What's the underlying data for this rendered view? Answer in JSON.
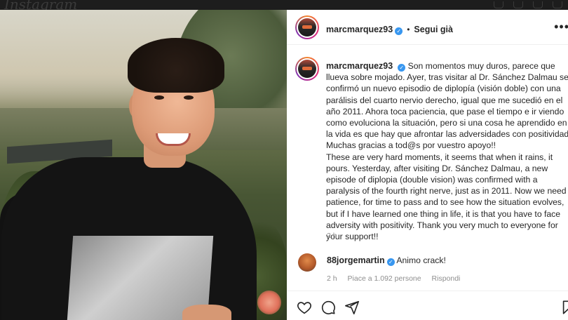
{
  "app": {
    "brand": "Instagram"
  },
  "post": {
    "author": "marcmarquez93",
    "follow_label": "Segui già",
    "more_label": "•••",
    "caption": "Son momentos muy duros, parece que llueva sobre mojado. Ayer, tras visitar al Dr. Sánchez Dalmau se confirmó un nuevo episodio de diplopía (visión doble) con una parálisis del cuarto nervio derecho, igual que me sucedió en el año 2011. Ahora toca paciencia, que pase el tiempo e ir viendo como evoluciona la situación, pero si una cosa he aprendido en la vida es que hay que afrontar las adversidades con positividad. Muchas gracias a tod@s por vuestro apoyo!!\nThese are very hard moments, it seems that when it rains, it pours. Yesterday, after visiting Dr. Sánchez Dalmau, a new episode of diplopia (double vision) was confirmed with a paralysis of the fourth right nerve, just as in 2011. Now we need patience, for time to pass and to see how the situation evolves, but if I have learned one thing in life, it is that you have to face adversity with positivity. Thank you very much to everyone for your support!!",
    "time": "2 h"
  },
  "comment": {
    "author": "88jorgemartin",
    "text": "Animo crack!",
    "time": "2 h",
    "likes": "Piace a 1.092 persone",
    "reply_label": "Rispondi"
  },
  "icons": [
    "heart-icon",
    "comment-icon",
    "share-icon",
    "bookmark-icon",
    "verified-icon",
    "more-icon"
  ],
  "colors": {
    "verified": "#3897f0",
    "text": "#262626",
    "muted": "#8e8e8e"
  }
}
